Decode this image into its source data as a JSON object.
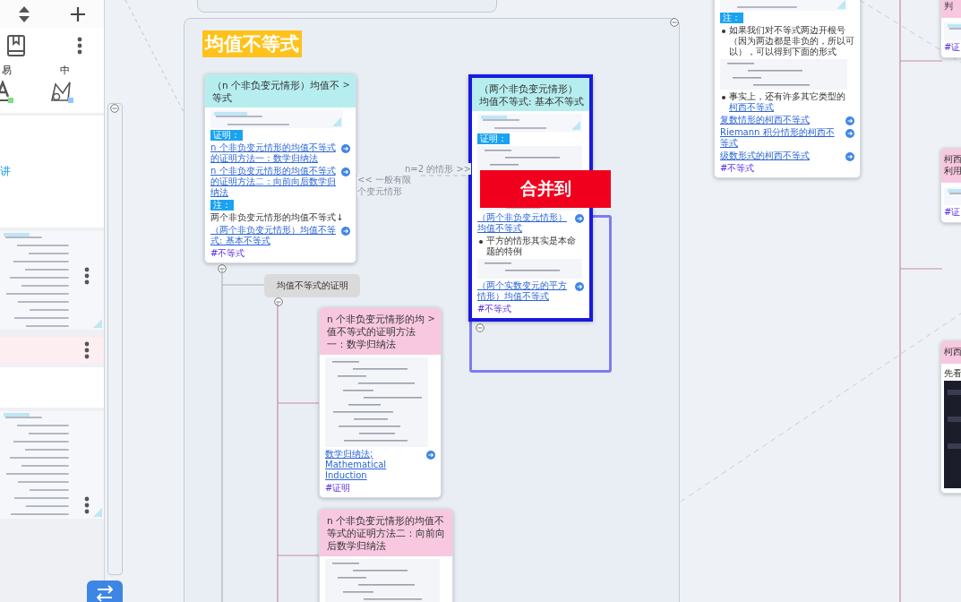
{
  "sidebar": {
    "labels": [
      {
        "text": "易",
        "color": "#7ee07e"
      },
      {
        "text": "中",
        "color": "#8cc8ff"
      }
    ],
    "note_link": "讲"
  },
  "canvas": {
    "title": "均值不等式",
    "edge_labels": [
      "n=2 的情形 >>",
      "<< 一般有限个变元情形"
    ],
    "proof_node": "均值不等式的证明",
    "merge_banner": "合并到",
    "cards": [
      {
        "title": "（n 个非负变元情形）均值不等式",
        "expand": ">",
        "color": "#b6eef0",
        "selected": false,
        "items": [
          {
            "kind": "picture"
          },
          {
            "kind": "tag",
            "text": "证明："
          },
          {
            "kind": "link",
            "text": "n 个非负变元情形的均值不等式的证明方法一：数学归纳法"
          },
          {
            "kind": "link",
            "text": "n 个非负变元情形的均值不等式的证明方法二：向前向后数学归纳法"
          },
          {
            "kind": "tag",
            "text": "注："
          },
          {
            "kind": "text",
            "text": "两个非负变元情形的均值不等式↓"
          },
          {
            "kind": "link",
            "text": "（两个非负变元情形）均值不等式: 基本不等式"
          },
          {
            "kind": "hashtag",
            "text": "#不等式"
          }
        ]
      },
      {
        "title": "（两个非负变元情形）均值不等式: 基本不等式",
        "color": "#b6eef0",
        "selected": true,
        "items": [
          {
            "kind": "picture"
          },
          {
            "kind": "tag",
            "text": "证明："
          },
          {
            "kind": "formula"
          },
          {
            "kind": "link",
            "text": "（两个非负变元情形）均值不等式"
          },
          {
            "kind": "bullet",
            "text": "平方的情形其实是本命题的特例"
          },
          {
            "kind": "formula"
          },
          {
            "kind": "link",
            "text": "（两个实数变元的平方情形）均值不等式"
          },
          {
            "kind": "hashtag",
            "text": "#不等式"
          }
        ]
      },
      {
        "title": "n 个非负变元情形的均值不等式的证明方法一：数学归纳法",
        "expand": ">",
        "color": "#f8c8e0",
        "selected": false,
        "items": [
          {
            "kind": "formula",
            "tall": true
          },
          {
            "kind": "link",
            "text": "数学归纳法; Mathematical Induction"
          },
          {
            "kind": "hashtag",
            "text": "#证明"
          }
        ]
      },
      {
        "title": "n 个非负变元情形的均值不等式的证明方法二：向前向后数学归纳法",
        "color": "#f8c8e0",
        "selected": false,
        "items": [
          {
            "kind": "formula",
            "tall": true
          }
        ]
      },
      {
        "color": "#ffffff",
        "selected": false,
        "items": [
          {
            "kind": "picture"
          },
          {
            "kind": "tag",
            "text": "注："
          },
          {
            "kind": "bullet",
            "text": "如果我们对不等式两边开根号（因为两边都是非负的，所以可以），可以得到下面的形式"
          },
          {
            "kind": "formula"
          },
          {
            "kind": "bullet",
            "text": "事实上，还有许多其它类型的",
            "link": "柯西不等式"
          },
          {
            "kind": "link",
            "text": "复数情形的柯西不等式"
          },
          {
            "kind": "link",
            "text": "Riemann 积分情形的柯西不等式"
          },
          {
            "kind": "link",
            "text": "级数形式的柯西不等式"
          },
          {
            "kind": "hashtag",
            "text": "#不等式"
          }
        ]
      }
    ],
    "side_cards": [
      {
        "title": "判",
        "items": [
          {
            "kind": "picture"
          },
          {
            "kind": "hashtag",
            "text": "#证"
          }
        ]
      },
      {
        "title": "柯西利用",
        "items": [
          {
            "kind": "picture"
          },
          {
            "kind": "hashtag",
            "text": "#证"
          }
        ]
      },
      {
        "title": "柯西",
        "items": [
          {
            "kind": "text",
            "text": "先看"
          },
          {
            "kind": "dark"
          }
        ]
      }
    ]
  }
}
